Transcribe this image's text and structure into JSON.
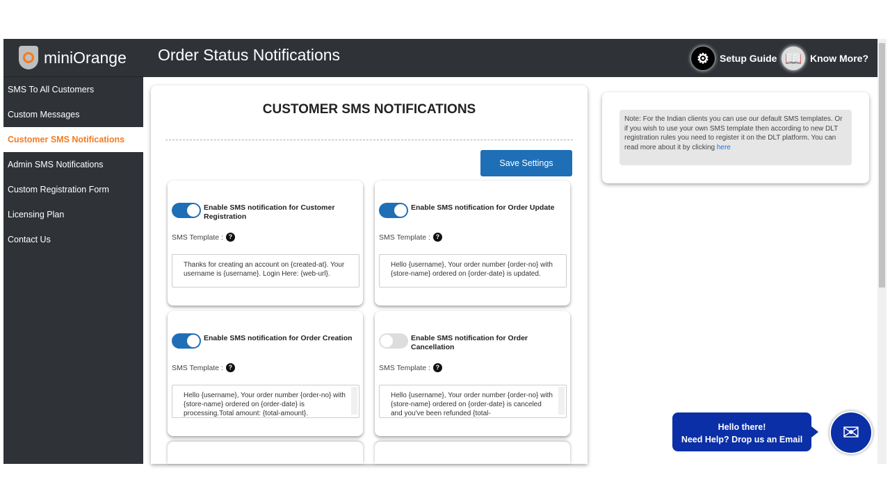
{
  "brand": "miniOrange",
  "header": {
    "title": "Order Status Notifications",
    "setup_guide": "Setup Guide",
    "know_more": "Know More?"
  },
  "sidebar": {
    "items": [
      {
        "label": "SMS To All Customers"
      },
      {
        "label": "Custom Messages"
      },
      {
        "label": "Customer SMS Notifications"
      },
      {
        "label": "Admin SMS Notifications"
      },
      {
        "label": "Custom Registration Form"
      },
      {
        "label": "Licensing Plan"
      },
      {
        "label": "Contact Us"
      }
    ]
  },
  "main": {
    "title": "CUSTOMER SMS NOTIFICATIONS",
    "save_label": "Save Settings",
    "template_label": "SMS Template :",
    "cards": [
      {
        "label": "Enable SMS notification for Customer Registration",
        "enabled": true,
        "template": "Thanks for creating an account on {created-at}. Your username is {username}. Login Here: {web-url}."
      },
      {
        "label": "Enable SMS notification for Order Update",
        "enabled": true,
        "template": "Hello {username}, Your order number {order-no} with {store-name} ordered on {order-date} is updated."
      },
      {
        "label": "Enable SMS notification for Order Creation",
        "enabled": true,
        "template": "Hello {username}, Your order number {order-no} with {store-name} ordered on {order-date} is processing.Total amount: {total-amount}."
      },
      {
        "label": "Enable SMS notification for Order Cancellation",
        "enabled": false,
        "template": "Hello {username}, Your order number {order-no} with {store-name} ordered on {order-date} is canceled and you've been refunded {total-"
      }
    ]
  },
  "note": {
    "text": "Note: For the Indian clients you can use our default SMS templates. Or if you wish to use your own SMS template then according to new DLT registration rules you need to register it on the DLT platform. You can read more about it by clicking ",
    "link": "here"
  },
  "help": {
    "line1": "Hello there!",
    "line2": "Need Help? Drop us an Email"
  },
  "colors": {
    "accent": "#f47b20",
    "primary": "#1f6fb6",
    "dark": "#2f3338",
    "help": "#0b2fa6"
  }
}
